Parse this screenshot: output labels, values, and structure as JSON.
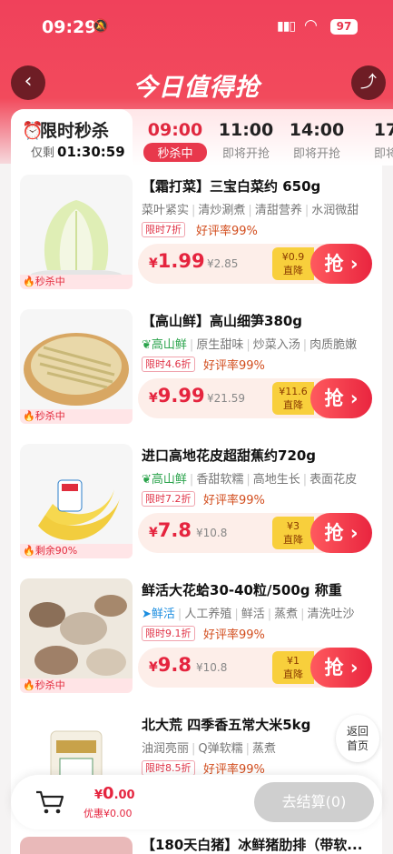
{
  "status_bar": {
    "time": "09:29",
    "battery": "97"
  },
  "nav": {
    "title": "今日值得抢"
  },
  "flash": {
    "title": "限时秒杀",
    "remain_label": "仅剩",
    "remain_time": "01:30:59"
  },
  "sessions": [
    {
      "time": "09:00",
      "status": "秒杀中"
    },
    {
      "time": "11:00",
      "status": "即将开抢"
    },
    {
      "time": "14:00",
      "status": "即将开抢"
    },
    {
      "time": "17",
      "status": "即将"
    }
  ],
  "products": [
    {
      "tag": "🔥秒杀中",
      "title": "【霜打菜】三宝白菜约 650g",
      "brand": "",
      "features": [
        "菜叶紧实",
        "清炒涮煮",
        "清甜营养",
        "水润微甜"
      ],
      "discount": "限时7折",
      "rating": "好评率99%",
      "price": "1.99",
      "original": "¥2.85",
      "drop_amount": "¥0.9",
      "drop_label": "直降",
      "button": "抢"
    },
    {
      "tag": "🔥秒杀中",
      "title": "【高山鲜】高山细笋380g",
      "brand": "高山鲜",
      "features": [
        "原生甜味",
        "炒菜入汤",
        "肉质脆嫩"
      ],
      "discount": "限时4.6折",
      "rating": "好评率99%",
      "price": "9.99",
      "original": "¥21.59",
      "drop_amount": "¥11.6",
      "drop_label": "直降",
      "button": "抢"
    },
    {
      "tag": "🔥剩余90%",
      "title": "进口高地花皮超甜蕉约720g",
      "brand": "高山鲜",
      "features": [
        "香甜软糯",
        "高地生长",
        "表面花皮"
      ],
      "discount": "限时7.2折",
      "rating": "好评率99%",
      "price": "7.8",
      "original": "¥10.8",
      "drop_amount": "¥3",
      "drop_label": "直降",
      "button": "抢"
    },
    {
      "tag": "🔥秒杀中",
      "title": "鲜活大花蛤30-40粒/500g 称重",
      "brand": "鲜活",
      "features": [
        "人工养殖",
        "鲜活",
        "蒸煮",
        "清洗吐沙"
      ],
      "discount": "限时9.1折",
      "rating": "好评率99%",
      "price": "9.8",
      "original": "¥10.8",
      "drop_amount": "¥1",
      "drop_label": "直降",
      "button": "抢"
    },
    {
      "tag": "",
      "title": "北大荒 四季香五常大米5kg",
      "brand": "",
      "features": [
        "油润亮丽",
        "Q弹软糯",
        "蒸煮"
      ],
      "discount": "限时8.5折",
      "rating": "好评率99%"
    }
  ],
  "next_title": "【180天白猪】冰鲜猪肋排（带软...",
  "float_home": [
    "返回",
    "首页"
  ],
  "cart": {
    "currency": "¥",
    "total_int": "0",
    "total_dec": ".00",
    "saving": "优惠¥0.00",
    "checkout": "去结算(0)"
  }
}
